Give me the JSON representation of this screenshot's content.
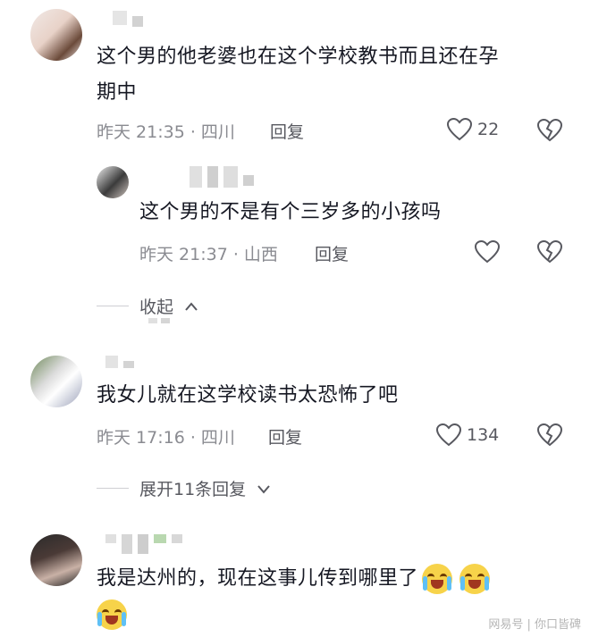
{
  "comments": [
    {
      "text_line1": "这个男的他老婆也在这个学校教书而且还在孕",
      "text_line2": "期中",
      "meta": "昨天 21:35 · 四川",
      "reply_label": "回复",
      "likes": "22"
    },
    {
      "text": "这个男的不是有个三岁多的小孩吗",
      "meta": "昨天 21:37 · 山西",
      "reply_label": "回复"
    },
    {
      "text": "我女儿就在这学校读书太恐怖了吧",
      "meta": "昨天 17:16 · 四川",
      "reply_label": "回复",
      "likes": "134"
    },
    {
      "text": "我是达州的，现在这事儿传到哪里了"
    }
  ],
  "collapse_label": "收起",
  "expand_label": "展开11条回复",
  "watermark": "网易号 | 你口皆碑"
}
